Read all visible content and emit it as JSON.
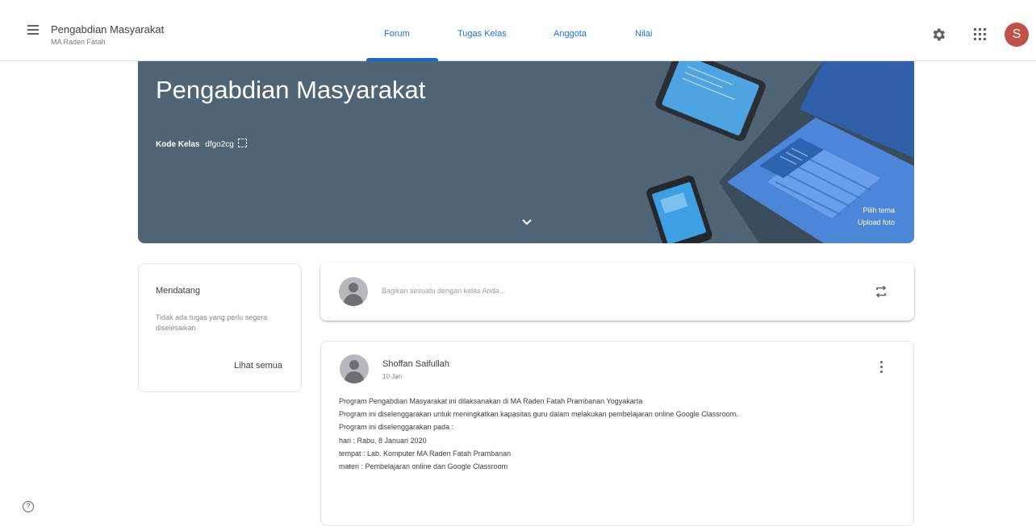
{
  "header": {
    "class_title": "Pengabdian Masyarakat",
    "class_subtitle": "MA Raden Fatah",
    "tabs": [
      {
        "label": "Forum",
        "active": true
      },
      {
        "label": "Tugas Kelas",
        "active": false
      },
      {
        "label": "Anggota",
        "active": false
      },
      {
        "label": "Nilai",
        "active": false
      }
    ],
    "avatar_letter": "S",
    "icons": [
      "menu-icon",
      "settings-icon",
      "apps-icon"
    ]
  },
  "banner": {
    "title": "Pengabdian Masyarakat",
    "code_label": "Kode Kelas",
    "code_value": "dfgo2cg",
    "links": [
      "Pilih tema",
      "Upload foto"
    ],
    "colors": {
      "background": "#4f6474"
    }
  },
  "upcoming": {
    "title": "Mendatang",
    "empty_text": "Tidak ada tugas yang perlu segera diselesaikan",
    "view_all": "Lihat semua"
  },
  "share": {
    "placeholder": "Bagikan sesuatu dengan kelas Anda..."
  },
  "post": {
    "author": "Shoffan Saifullah",
    "time": "10 Jan",
    "lines": [
      "Program Pengabdian Masyarakat ini dilaksanakan di MA Raden Fatah Prambanan Yogyakarta",
      "Program ini diselenggarakan untuk meningkatkan kapasitas guru dalam melakukan pembelajaran online Google Classroom.",
      "Program ini diselenggarakan pada :",
      "hari : Rabu, 8 Januari 2020",
      "tempat : Lab. Komputer MA Raden Fatah Prambanan",
      "materi : Pembelajaran online dan Google Classroom"
    ]
  },
  "colors": {
    "accent": "#1a73e8",
    "avatar": "#c0524a"
  }
}
